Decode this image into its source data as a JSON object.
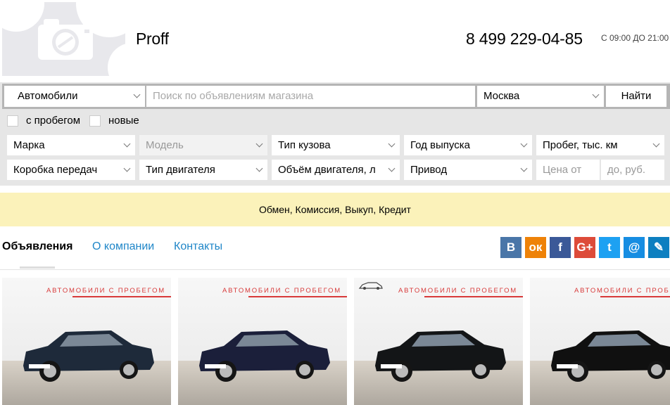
{
  "header": {
    "shop_name": "Proff",
    "phone": "8 499 229-04-85",
    "hours": "С 09:00 ДО 21:00",
    "logo_icon": "camera-placeholder-icon"
  },
  "search": {
    "category": "Автомобили",
    "query_placeholder": "Поиск по объявлениям магазина",
    "city": "Москва",
    "find_label": "Найти",
    "checkbox_used": "с пробегом",
    "checkbox_new": "новые"
  },
  "filters": {
    "make": "Марка",
    "model": "Модель",
    "body_type": "Тип кузова",
    "year": "Год выпуска",
    "mileage": "Пробег, тыс. км",
    "gearbox": "Коробка передач",
    "engine_type": "Тип двигателя",
    "engine_volume": "Объём двигателя, л",
    "drive": "Привод",
    "price_from": "Цена от",
    "price_to": "до, руб."
  },
  "banner": "Обмен, Комиссия, Выкуп, Кредит",
  "tabs": [
    {
      "label": "Объявления",
      "active": true
    },
    {
      "label": "О компании",
      "active": false
    },
    {
      "label": "Контакты",
      "active": false
    }
  ],
  "social": [
    {
      "icon": "vk-icon",
      "glyph": "В",
      "color": "#4a76a8"
    },
    {
      "icon": "odnoklassniki-icon",
      "glyph": "ок",
      "color": "#ee8208"
    },
    {
      "icon": "facebook-icon",
      "glyph": "f",
      "color": "#3b5998"
    },
    {
      "icon": "google-plus-icon",
      "glyph": "G+",
      "color": "#dd4b39"
    },
    {
      "icon": "twitter-icon",
      "glyph": "t",
      "color": "#1da1f2"
    },
    {
      "icon": "mail-icon",
      "glyph": "@",
      "color": "#168de2"
    },
    {
      "icon": "livejournal-icon",
      "glyph": "✎",
      "color": "#0d7fc0"
    }
  ],
  "listings": [
    {
      "watermark": "АВТОМОБИЛИ С ПРОБЕГОМ",
      "car_color": "#1e2a3a"
    },
    {
      "watermark": "АВТОМОБИЛИ С ПРОБЕГОМ",
      "car_color": "#1b1f3a"
    },
    {
      "watermark": "АВТОМОБИЛИ С ПРОБЕГОМ",
      "car_color": "#131517"
    },
    {
      "watermark": "АВТОМОБИЛИ С ПРОБЕГОМ",
      "car_color": "#101010"
    }
  ]
}
